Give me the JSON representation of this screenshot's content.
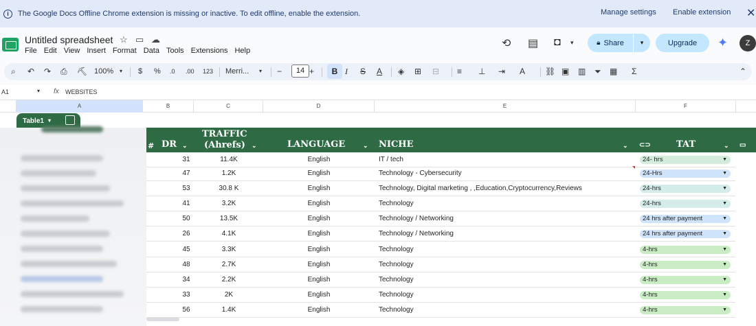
{
  "banner": {
    "message": "The Google Docs Offline Chrome extension is missing or inactive. To edit offline, enable the extension.",
    "manage_settings": "Manage settings",
    "enable_extension": "Enable extension",
    "close": "✕"
  },
  "doc": {
    "title": "Untitled spreadsheet",
    "menu": [
      "File",
      "Edit",
      "View",
      "Insert",
      "Format",
      "Data",
      "Tools",
      "Extensions",
      "Help"
    ]
  },
  "actions": {
    "share": "Share",
    "upgrade": "Upgrade",
    "avatar_initial": "Z"
  },
  "toolbar": {
    "zoom": "100%",
    "currency": "$",
    "percent": "%",
    "dec_decrease": ".0",
    "dec_increase": ".00",
    "number_format": "123",
    "font": "Merri...",
    "font_size": "14",
    "bold": "B",
    "italic": "I",
    "strike": "S",
    "text_color": "A",
    "sigma": "Σ"
  },
  "formula_bar": {
    "cell_ref": "A1",
    "fx": "fx",
    "value": "WEBSITES"
  },
  "columns": [
    "A",
    "B",
    "C",
    "D",
    "E",
    "F"
  ],
  "table": {
    "name": "Table1",
    "headers": {
      "hash": "#",
      "dr": "DR",
      "traffic_line1": "TRAFFIC",
      "traffic_line2": "(Ahrefs)",
      "language": "LANGUAGE",
      "niche": "NICHE",
      "tat": "TAT"
    },
    "rows": [
      {
        "dr": "31",
        "traffic": "11.4K",
        "language": "English",
        "niche": "IT / tech",
        "tat": "24- hrs",
        "tat_color": "#d4ecdc"
      },
      {
        "dr": "47",
        "traffic": "1.2K",
        "language": "English",
        "niche": "Technology - Cybersecurity",
        "tat": "24-Hrs",
        "tat_color": "#cfe3fb"
      },
      {
        "dr": "53",
        "traffic": "30.8 K",
        "language": "English",
        "niche": "Technology, Digital marketing ,  ,Education,Cryptocurrency,Reviews",
        "tat": "24-hrs",
        "tat_color": "#d4ecea"
      },
      {
        "dr": "41",
        "traffic": "3.2K",
        "language": "English",
        "niche": "Technology",
        "tat": "24-hrs",
        "tat_color": "#d4ecea"
      },
      {
        "dr": "50",
        "traffic": "13.5K",
        "language": "English",
        "niche": "Technology / Networking",
        "tat": "24 hrs after payment",
        "tat_color": "#cfe3fb"
      },
      {
        "dr": "26",
        "traffic": "4.1K",
        "language": "English",
        "niche": "Technology / Networking",
        "tat": "24 hrs after payment",
        "tat_color": "#cfe3fb"
      },
      {
        "dr": "45",
        "traffic": "3.3K",
        "language": "English",
        "niche": "Technology",
        "tat": "4-hrs",
        "tat_color": "#c9ecc4"
      },
      {
        "dr": "48",
        "traffic": "2.7K",
        "language": "English",
        "niche": "Technology",
        "tat": "4-hrs",
        "tat_color": "#c9ecc4"
      },
      {
        "dr": "34",
        "traffic": "2.2K",
        "language": "English",
        "niche": "Technology",
        "tat": "4-hrs",
        "tat_color": "#c9ecc4"
      },
      {
        "dr": "33",
        "traffic": "2K",
        "language": "English",
        "niche": "Technology",
        "tat": "4-hrs",
        "tat_color": "#c9ecc4"
      },
      {
        "dr": "56",
        "traffic": "1.4K",
        "language": "English",
        "niche": "Technology",
        "tat": "4-hrs",
        "tat_color": "#c9ecc4"
      }
    ]
  },
  "colors": {
    "table_header": "#2e6b45",
    "banner_bg": "#e2eaf9",
    "share_bg": "#c2e7ff"
  }
}
